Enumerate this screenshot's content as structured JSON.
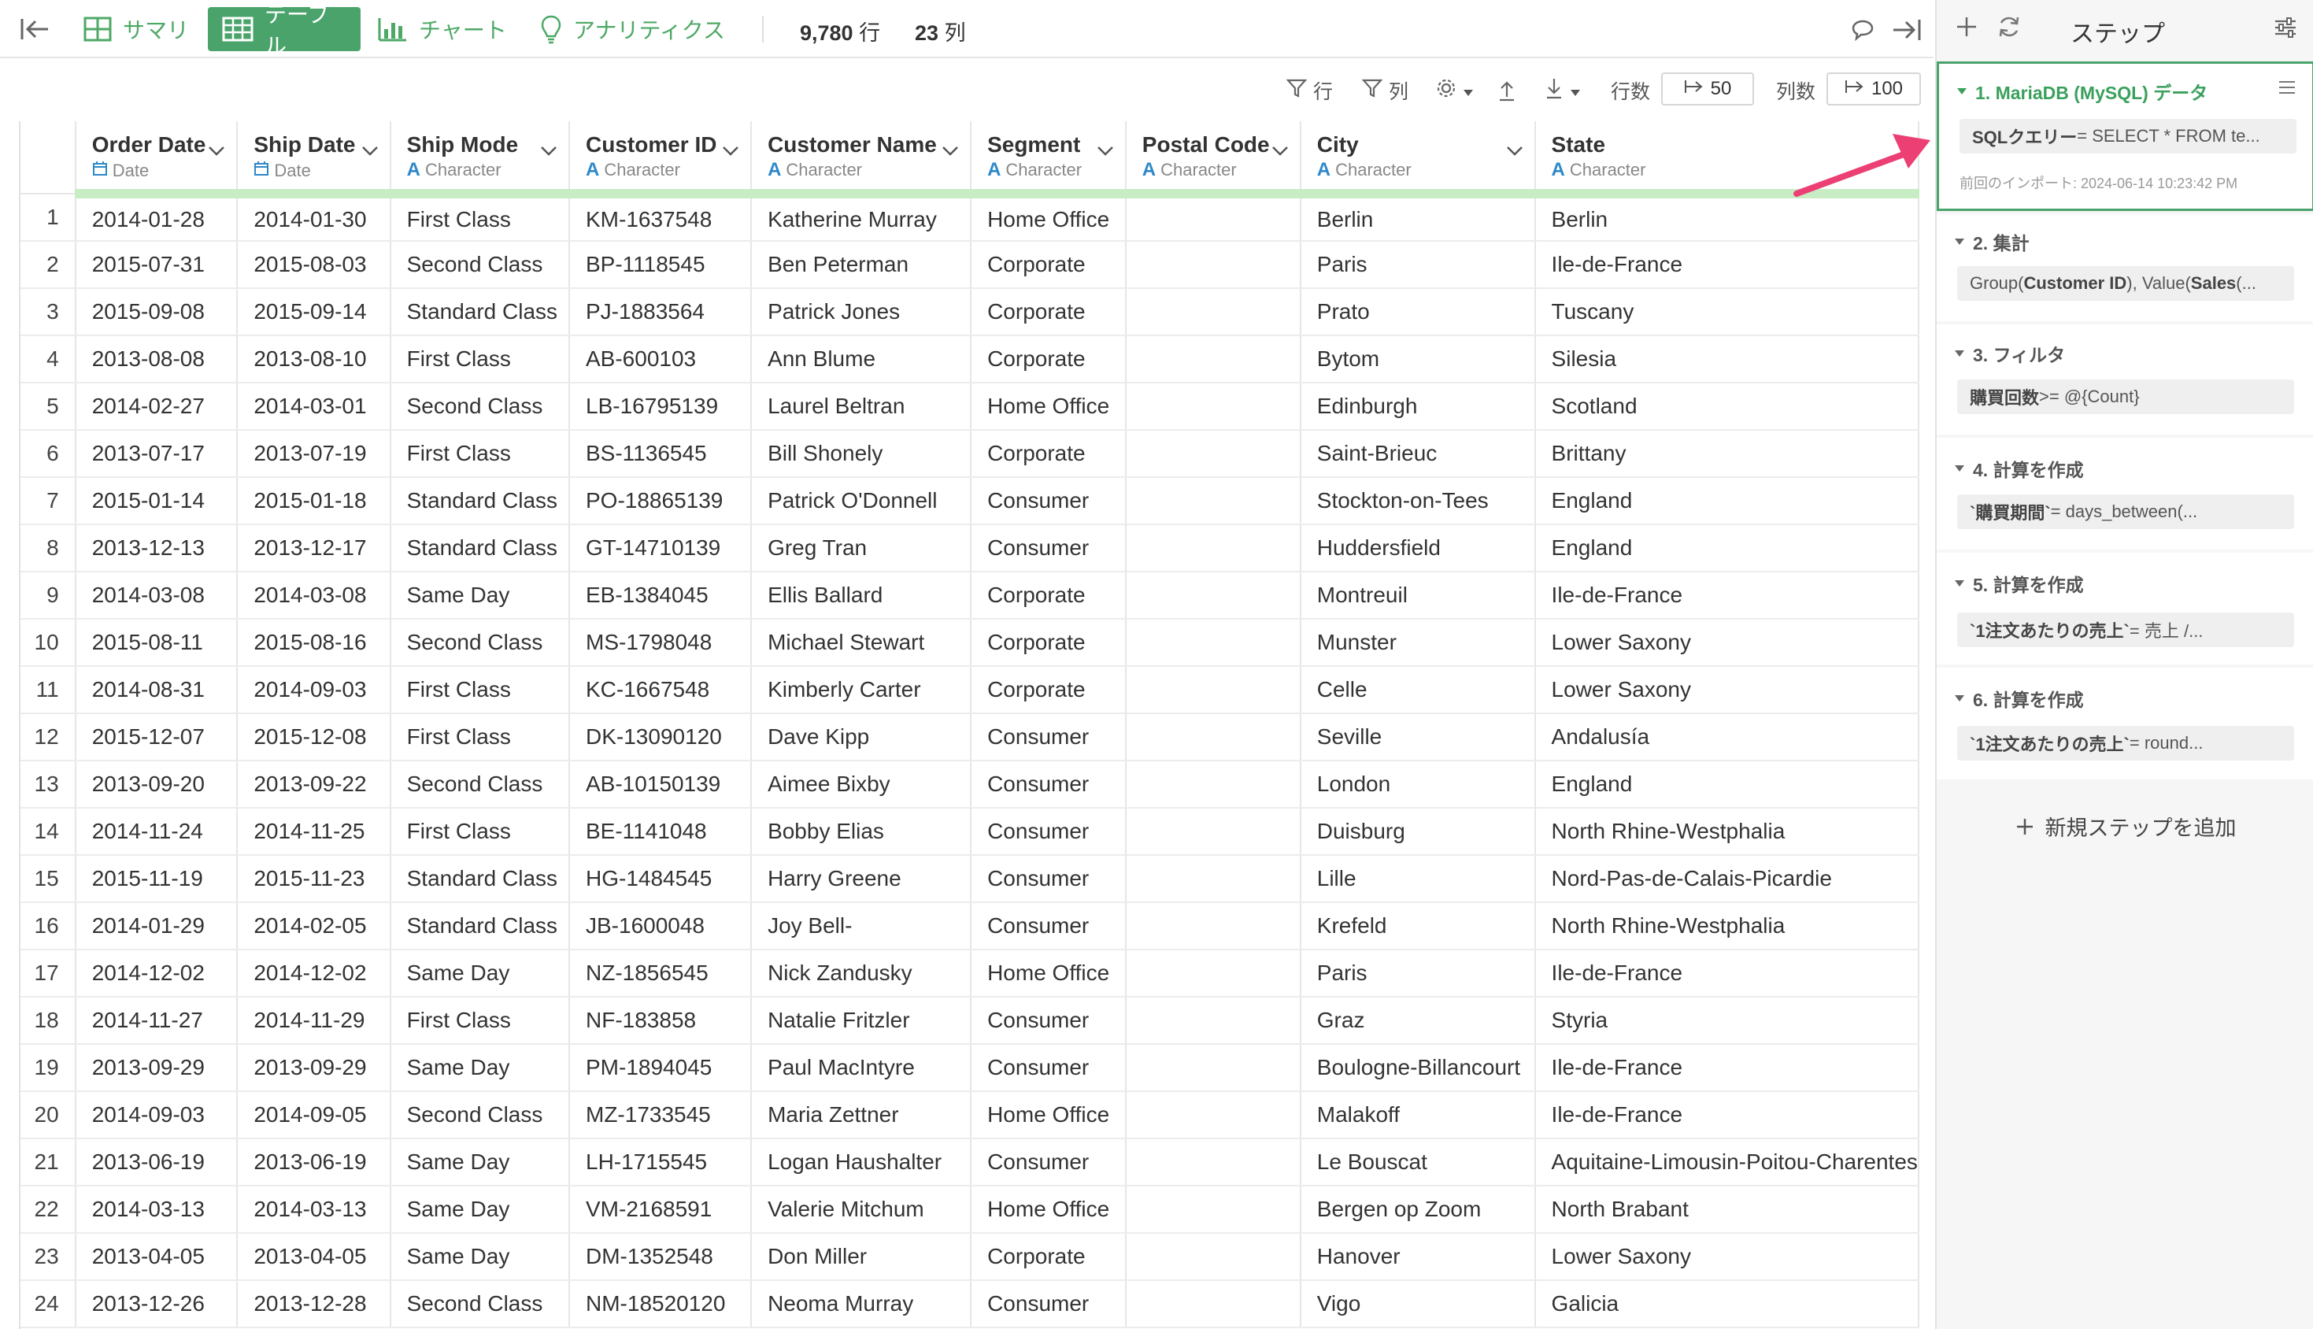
{
  "topbar": {
    "tabs": [
      {
        "label": "サマリ",
        "icon": "summary-grid-icon",
        "active": false
      },
      {
        "label": "テーブル",
        "icon": "table-icon",
        "active": true
      },
      {
        "label": "チャート",
        "icon": "bar-chart-icon",
        "active": false
      },
      {
        "label": "アナリティクス",
        "icon": "lightbulb-icon",
        "active": false
      }
    ],
    "rows": "9,780",
    "rows_unit": "行",
    "cols": "23",
    "cols_unit": "列"
  },
  "toolbar2": {
    "row_filter": "行",
    "col_filter": "列",
    "rows_label": "行数",
    "rows_value": "50",
    "cols_label": "列数",
    "cols_value": "100"
  },
  "table": {
    "columns": [
      {
        "name": "Order Date",
        "type": "Date",
        "type_icon": "calendar-icon"
      },
      {
        "name": "Ship Date",
        "type": "Date",
        "type_icon": "calendar-icon"
      },
      {
        "name": "Ship Mode",
        "type": "Character",
        "type_icon": "A"
      },
      {
        "name": "Customer ID",
        "type": "Character",
        "type_icon": "A"
      },
      {
        "name": "Customer Name",
        "type": "Character",
        "type_icon": "A"
      },
      {
        "name": "Segment",
        "type": "Character",
        "type_icon": "A"
      },
      {
        "name": "Postal Code",
        "type": "Character",
        "type_icon": "A"
      },
      {
        "name": "City",
        "type": "Character",
        "type_icon": "A"
      },
      {
        "name": "State",
        "type": "Character",
        "type_icon": "A"
      }
    ],
    "rows": [
      [
        "1",
        "2014-01-28",
        "2014-01-30",
        "First Class",
        "KM-1637548",
        "Katherine Murray",
        "Home Office",
        "",
        "Berlin",
        "Berlin"
      ],
      [
        "2",
        "2015-07-31",
        "2015-08-03",
        "Second Class",
        "BP-1118545",
        "Ben Peterman",
        "Corporate",
        "",
        "Paris",
        "Ile-de-France"
      ],
      [
        "3",
        "2015-09-08",
        "2015-09-14",
        "Standard Class",
        "PJ-1883564",
        "Patrick Jones",
        "Corporate",
        "",
        "Prato",
        "Tuscany"
      ],
      [
        "4",
        "2013-08-08",
        "2013-08-10",
        "First Class",
        "AB-600103",
        "Ann Blume",
        "Corporate",
        "",
        "Bytom",
        "Silesia"
      ],
      [
        "5",
        "2014-02-27",
        "2014-03-01",
        "Second Class",
        "LB-16795139",
        "Laurel Beltran",
        "Home Office",
        "",
        "Edinburgh",
        "Scotland"
      ],
      [
        "6",
        "2013-07-17",
        "2013-07-19",
        "First Class",
        "BS-1136545",
        "Bill Shonely",
        "Corporate",
        "",
        "Saint-Brieuc",
        "Brittany"
      ],
      [
        "7",
        "2015-01-14",
        "2015-01-18",
        "Standard Class",
        "PO-18865139",
        "Patrick O'Donnell",
        "Consumer",
        "",
        "Stockton-on-Tees",
        "England"
      ],
      [
        "8",
        "2013-12-13",
        "2013-12-17",
        "Standard Class",
        "GT-14710139",
        "Greg Tran",
        "Consumer",
        "",
        "Huddersfield",
        "England"
      ],
      [
        "9",
        "2014-03-08",
        "2014-03-08",
        "Same Day",
        "EB-1384045",
        "Ellis Ballard",
        "Corporate",
        "",
        "Montreuil",
        "Ile-de-France"
      ],
      [
        "10",
        "2015-08-11",
        "2015-08-16",
        "Second Class",
        "MS-1798048",
        "Michael Stewart",
        "Corporate",
        "",
        "Munster",
        "Lower Saxony"
      ],
      [
        "11",
        "2014-08-31",
        "2014-09-03",
        "First Class",
        "KC-1667548",
        "Kimberly Carter",
        "Corporate",
        "",
        "Celle",
        "Lower Saxony"
      ],
      [
        "12",
        "2015-12-07",
        "2015-12-08",
        "First Class",
        "DK-13090120",
        "Dave Kipp",
        "Consumer",
        "",
        "Seville",
        "Andalusía"
      ],
      [
        "13",
        "2013-09-20",
        "2013-09-22",
        "Second Class",
        "AB-10150139",
        "Aimee Bixby",
        "Consumer",
        "",
        "London",
        "England"
      ],
      [
        "14",
        "2014-11-24",
        "2014-11-25",
        "First Class",
        "BE-1141048",
        "Bobby Elias",
        "Consumer",
        "",
        "Duisburg",
        "North Rhine-Westphalia"
      ],
      [
        "15",
        "2015-11-19",
        "2015-11-23",
        "Standard Class",
        "HG-1484545",
        "Harry Greene",
        "Consumer",
        "",
        "Lille",
        "Nord-Pas-de-Calais-Picardie"
      ],
      [
        "16",
        "2014-01-29",
        "2014-02-05",
        "Standard Class",
        "JB-1600048",
        "Joy Bell-",
        "Consumer",
        "",
        "Krefeld",
        "North Rhine-Westphalia"
      ],
      [
        "17",
        "2014-12-02",
        "2014-12-02",
        "Same Day",
        "NZ-1856545",
        "Nick Zandusky",
        "Home Office",
        "",
        "Paris",
        "Ile-de-France"
      ],
      [
        "18",
        "2014-11-27",
        "2014-11-29",
        "First Class",
        "NF-183858",
        "Natalie Fritzler",
        "Consumer",
        "",
        "Graz",
        "Styria"
      ],
      [
        "19",
        "2013-09-29",
        "2013-09-29",
        "Same Day",
        "PM-1894045",
        "Paul MacIntyre",
        "Consumer",
        "",
        "Boulogne-Billancourt",
        "Ile-de-France"
      ],
      [
        "20",
        "2014-09-03",
        "2014-09-05",
        "Second Class",
        "MZ-1733545",
        "Maria Zettner",
        "Home Office",
        "",
        "Malakoff",
        "Ile-de-France"
      ],
      [
        "21",
        "2013-06-19",
        "2013-06-19",
        "Same Day",
        "LH-1715545",
        "Logan Haushalter",
        "Consumer",
        "",
        "Le Bouscat",
        "Aquitaine-Limousin-Poitou-Charentes"
      ],
      [
        "22",
        "2014-03-13",
        "2014-03-13",
        "Same Day",
        "VM-2168591",
        "Valerie Mitchum",
        "Home Office",
        "",
        "Bergen op Zoom",
        "North Brabant"
      ],
      [
        "23",
        "2013-04-05",
        "2013-04-05",
        "Same Day",
        "DM-1352548",
        "Don Miller",
        "Corporate",
        "",
        "Hanover",
        "Lower Saxony"
      ],
      [
        "24",
        "2013-12-26",
        "2013-12-28",
        "Second Class",
        "NM-18520120",
        "Neoma Murray",
        "Consumer",
        "",
        "Vigo",
        "Galicia"
      ]
    ]
  },
  "steps_panel": {
    "title": "ステップ",
    "steps": [
      {
        "title": "1. MariaDB (MySQL) データ",
        "body_key": "SQLクエリー",
        "body_rest": " = SELECT * FROM te...",
        "meta": "前回のインポート: 2024-06-14 10:23:42 PM",
        "active": true
      },
      {
        "title": "2. 集計",
        "body_html": [
          "Group(",
          "Customer ID",
          "), Value(",
          "Sales",
          " (..."
        ],
        "active": false
      },
      {
        "title": "3. フィルタ",
        "body_key": "購買回数",
        "body_rest": " >= @{Count}",
        "active": false
      },
      {
        "title": "4. 計算を作成",
        "body_key": "`購買期間`",
        "body_rest": " = days_between(...",
        "active": false
      },
      {
        "title": "5. 計算を作成",
        "body_key": "`1注文あたりの売上`",
        "body_rest": " = 売上 /...",
        "active": false
      },
      {
        "title": "6. 計算を作成",
        "body_key": "`1注文あたりの売上`",
        "body_rest": " = round...",
        "active": false
      }
    ],
    "add_step": "新規ステップを追加"
  },
  "colors": {
    "accent_green": "#4aa36a",
    "type_blue": "#2d88c8",
    "header_underline": "#c8ecc4",
    "arrow_pink": "#ec3f74"
  }
}
